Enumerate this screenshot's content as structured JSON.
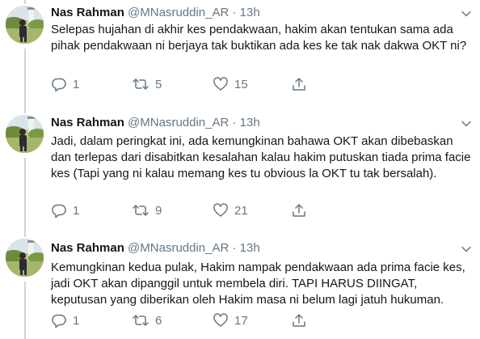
{
  "tweets": [
    {
      "name": "Nas Rahman",
      "handle": "@MNasruddin_AR",
      "separator": "·",
      "time": "13h",
      "text": "Selepas hujahan di akhir kes pendakwaan, hakim akan tentukan sama ada pihak pendakwaan ni berjaya tak buktikan ada kes ke tak nak dakwa OKT ni?",
      "replies": "1",
      "retweets": "5",
      "likes": "15"
    },
    {
      "name": "Nas Rahman",
      "handle": "@MNasruddin_AR",
      "separator": "·",
      "time": "13h",
      "text": "Jadi, dalam peringkat ini, ada kemungkinan bahawa OKT akan dibebaskan dan terlepas dari disabitkan kesalahan kalau hakim putuskan tiada prima facie kes (Tapi yang ni kalau memang kes tu obvious la OKT tu tak bersalah).",
      "replies": "1",
      "retweets": "9",
      "likes": "21"
    },
    {
      "name": "Nas Rahman",
      "handle": "@MNasruddin_AR",
      "separator": "·",
      "time": "13h",
      "text": "Kemungkinan kedua pulak, Hakim nampak pendakwaan ada prima facie kes, jadi OKT akan dipanggil untuk membela diri. TAPI HARUS DIINGAT, keputusan yang diberikan oleh Hakim masa ni belum lagi jatuh hukuman.",
      "replies": "1",
      "retweets": "6",
      "likes": "17"
    }
  ],
  "icons": {
    "reply": "reply-icon",
    "retweet": "retweet-icon",
    "like": "like-icon",
    "share": "share-icon",
    "more": "chevron-down-icon"
  },
  "colors": {
    "text": "#14171a",
    "muted": "#657786",
    "thread_line": "#ccd6dd",
    "divider": "#e6ecf0"
  }
}
